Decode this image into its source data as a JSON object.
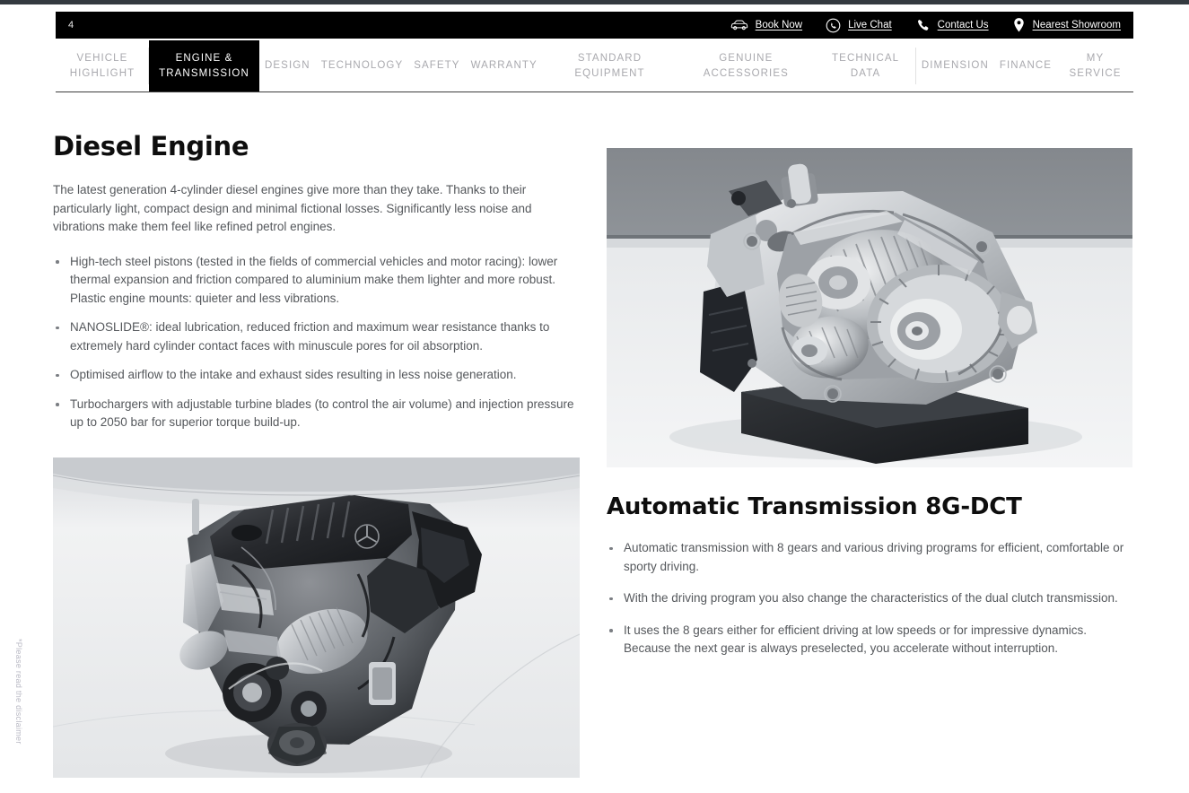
{
  "utility_bar": {
    "page_number": "4",
    "links": [
      {
        "label": "Book Now",
        "icon": "car-icon"
      },
      {
        "label": "Live Chat",
        "icon": "whatsapp-icon"
      },
      {
        "label": "Contact Us",
        "icon": "phone-icon"
      },
      {
        "label": "Nearest Showroom",
        "icon": "map-pin-icon"
      }
    ]
  },
  "tabs": [
    {
      "label": "VEHICLE HIGHLIGHT",
      "active": false
    },
    {
      "label": "ENGINE & TRANSMISSION",
      "active": true
    },
    {
      "label": "DESIGN",
      "active": false
    },
    {
      "label": "TECHNOLOGY",
      "active": false
    },
    {
      "label": "SAFETY",
      "active": false
    },
    {
      "label": "WARRANTY",
      "active": false
    },
    {
      "label": "STANDARD EQUIPMENT",
      "active": false
    },
    {
      "label": "GENUINE ACCESSORIES",
      "active": false
    },
    {
      "label": "TECHNICAL DATA",
      "active": false
    },
    {
      "label": "DIMENSION",
      "active": false
    },
    {
      "label": "FINANCE",
      "active": false
    },
    {
      "label": "MY SERVICE",
      "active": false
    }
  ],
  "left_column": {
    "title": "Diesel Engine",
    "intro": "The latest generation 4-cylinder diesel engines give more than they take. Thanks to their particularly light, compact design and minimal fictional losses. Significantly less noise and vibrations make them feel like refined petrol engines.",
    "bullets": [
      "High-tech steel pistons (tested in the fields of commercial vehicles and motor racing): lower thermal expansion and friction compared to aluminium make them lighter and more robust. Plastic engine mounts: quieter and less vibrations.",
      "NANOSLIDE®: ideal lubrication, reduced friction and maximum wear resistance thanks to extremely hard cylinder contact faces with minuscule pores for oil absorption.",
      "Optimised airflow to the intake and exhaust sides resulting in less noise generation.",
      "Turbochargers with adjustable turbine blades (to control the air volume) and injection pressure up to 2050 bar for superior torque build-up."
    ],
    "image_name": "diesel-engine-photo"
  },
  "right_column": {
    "title": "Automatic Transmission 8G-DCT",
    "bullets": [
      "Automatic transmission with 8 gears and various driving programs for efficient, comfortable or sporty driving.",
      "With the driving program you also change the characteristics of the dual clutch transmission.",
      "It uses the 8 gears either for efficient driving at low speeds or for impressive dynamics. Because the next gear is always preselected, you accelerate without interruption."
    ],
    "image_name": "automatic-transmission-photo"
  },
  "disclaimer": "*Please read the disclaimer",
  "colors": {
    "bar_background": "#000000",
    "active_tab_background": "#000000",
    "active_tab_text": "#ffffff",
    "inactive_tab_text": "#a9a9ae",
    "body_text": "#55585c",
    "heading_text": "#0e0e0e",
    "disclaimer_text": "#b9b9c4"
  }
}
